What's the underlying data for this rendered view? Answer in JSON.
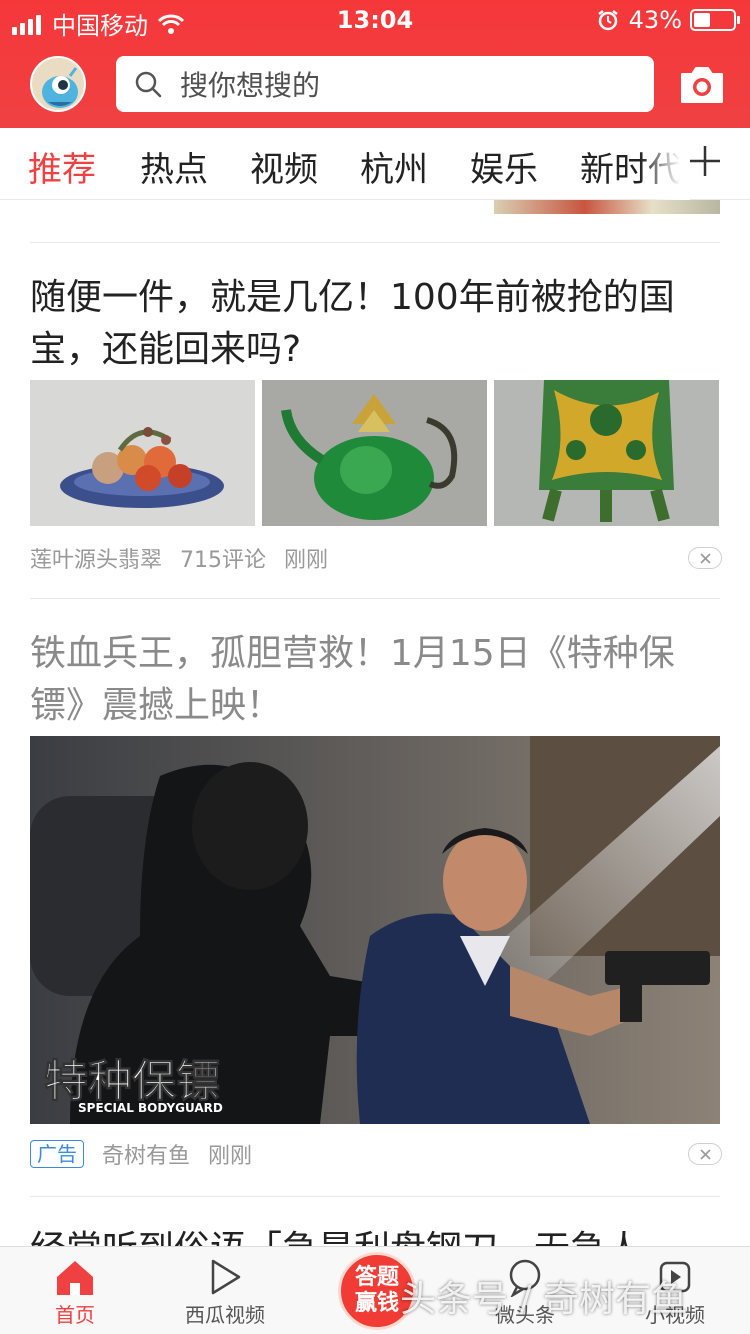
{
  "status_bar": {
    "carrier": "中国移动",
    "time": "13:04",
    "battery": "43%",
    "battery_level": 0.43
  },
  "header": {
    "search_placeholder": "搜你想搜的"
  },
  "tabs": [
    "推荐",
    "热点",
    "视频",
    "杭州",
    "娱乐",
    "新时代"
  ],
  "feed": {
    "items": [
      {
        "title": "随便一件，就是几亿！100年前被抢的国宝，还能回来吗?",
        "source": "莲叶源头翡翠",
        "comments": "715评论",
        "time": "刚刚"
      },
      {
        "title": "铁血兵王，孤胆营救！1月15日《特种保镖》震撼上映！",
        "ad_tag": "广告",
        "source": "奇树有鱼",
        "time": "刚刚",
        "image_caption": "特种保镖",
        "image_caption_en": "SPECIAL BODYGUARD"
      }
    ],
    "next_title_partial": "经常听到俗语「急是利盘钢刀，无急人"
  },
  "bottom_nav": {
    "items": [
      "首页",
      "西瓜视频",
      "微头条",
      "小视频"
    ],
    "center_button": [
      "答题",
      "赢钱"
    ]
  },
  "watermark": "头条号 / 奇树有鱼",
  "colors": {
    "brand_red": "#f04142",
    "ad_blue": "#3a8be0"
  }
}
